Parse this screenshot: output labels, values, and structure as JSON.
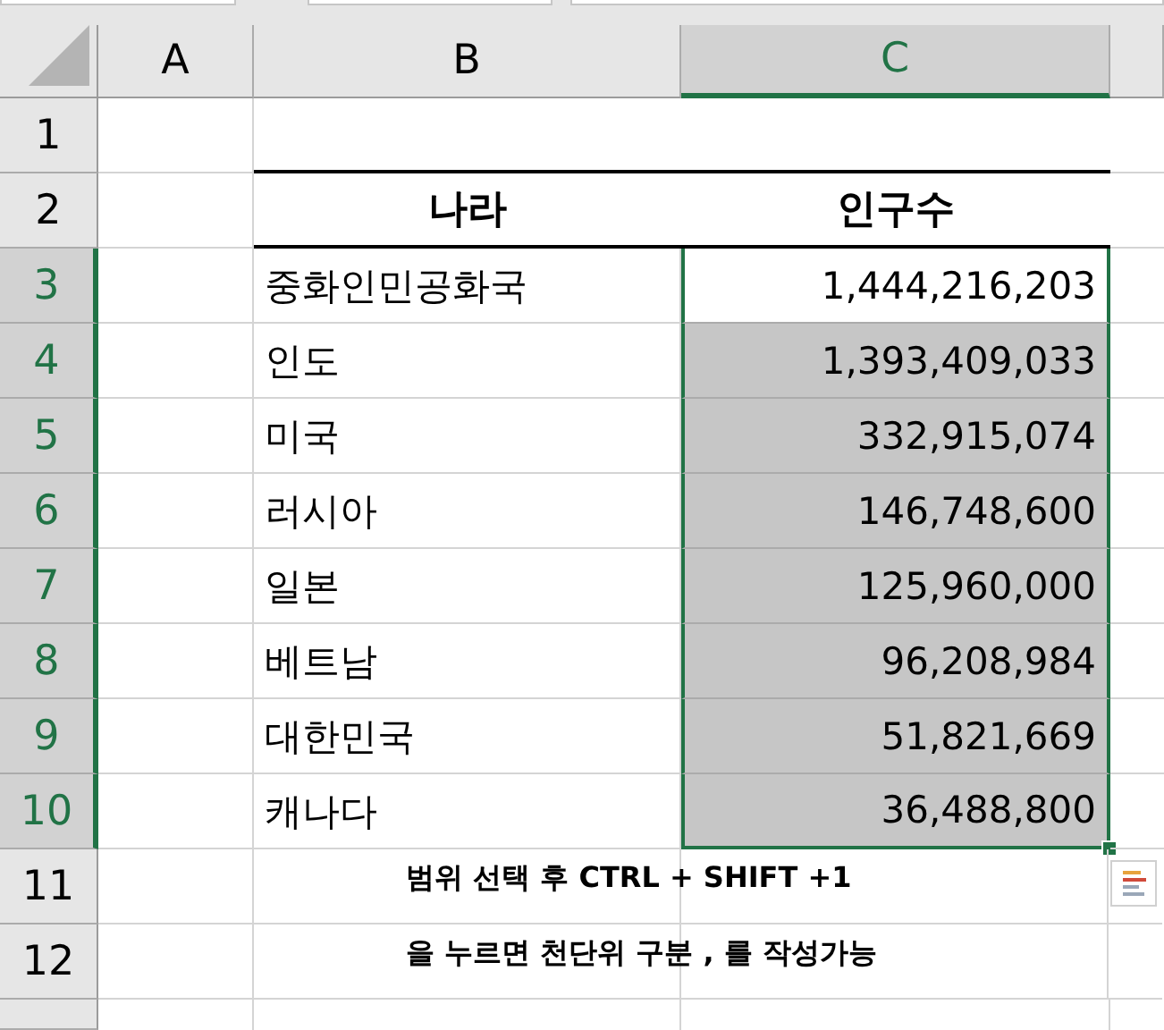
{
  "columns": [
    {
      "label": "A",
      "selected": false
    },
    {
      "label": "B",
      "selected": false
    },
    {
      "label": "C",
      "selected": true
    }
  ],
  "rows": [
    {
      "number": "1",
      "kind": "blank",
      "selected": false
    },
    {
      "number": "2",
      "kind": "table-header",
      "selected": false,
      "b": "나라",
      "c": "인구수"
    },
    {
      "number": "3",
      "kind": "data",
      "selected": true,
      "active": true,
      "b": "중화인민공화국",
      "c": "1,444,216,203"
    },
    {
      "number": "4",
      "kind": "data",
      "selected": true,
      "active": false,
      "b": "인도",
      "c": "1,393,409,033"
    },
    {
      "number": "5",
      "kind": "data",
      "selected": true,
      "active": false,
      "b": "미국",
      "c": "332,915,074"
    },
    {
      "number": "6",
      "kind": "data",
      "selected": true,
      "active": false,
      "b": "러시아",
      "c": "146,748,600"
    },
    {
      "number": "7",
      "kind": "data",
      "selected": true,
      "active": false,
      "b": "일본",
      "c": "125,960,000"
    },
    {
      "number": "8",
      "kind": "data",
      "selected": true,
      "active": false,
      "b": "베트남",
      "c": "96,208,984"
    },
    {
      "number": "9",
      "kind": "data",
      "selected": true,
      "active": false,
      "b": "대한민국",
      "c": "51,821,669"
    },
    {
      "number": "10",
      "kind": "data",
      "selected": true,
      "active": false,
      "b": "캐나다",
      "c": "36,488,800"
    },
    {
      "number": "11",
      "kind": "note",
      "selected": false,
      "text": "범위 선택 후 CTRL + SHIFT +1"
    },
    {
      "number": "12",
      "kind": "note",
      "selected": false,
      "text": "을 누르면 천단위 구분 , 를 작성가능"
    },
    {
      "kind": "blank",
      "selected": false
    }
  ]
}
